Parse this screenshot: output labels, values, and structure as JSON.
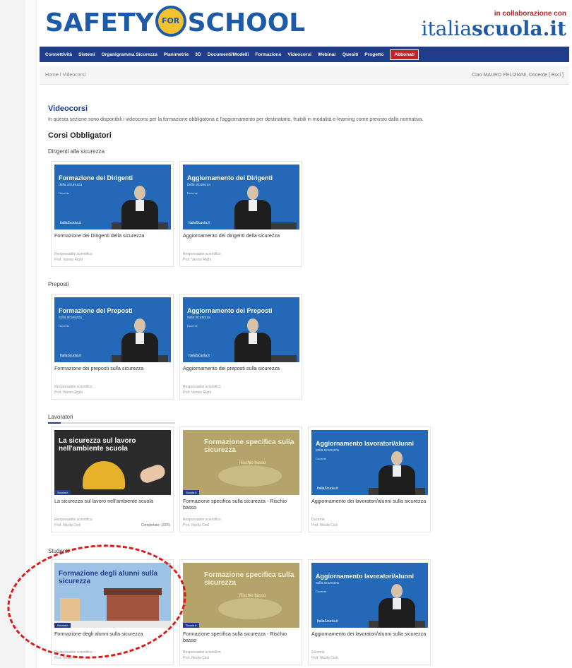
{
  "header": {
    "logo_left": "SAFETY",
    "logo_badge": "FOR",
    "logo_right": "SCHOOL",
    "partner_note": "in collaborazione con",
    "partner_light": "italia",
    "partner_bold": "scuola.it"
  },
  "nav": {
    "items": [
      "Connettività",
      "Sistemi",
      "Organigramma Sicurezza",
      "Planimetrie",
      "3D",
      "Documenti/Modelli",
      "Formazione",
      "Videocorsi",
      "Webinar",
      "Quesiti",
      "Progetto",
      "Abbonati"
    ]
  },
  "crumb": "Home / Videocorsi",
  "user": "Ciao MAURO FELIZIANI, Docente [ Esci ]",
  "section": {
    "title": "Videocorsi",
    "description": "In questa sezione sono disponibili i videocorsi per la formazione obbligatoria e l'aggiornamento per destinatario, fruibili in modalità e-learning come previsto dalla normativa.",
    "subtitle": "Corsi Obbligatori"
  },
  "groups": [
    {
      "label": "Dirigenti alla sicurezza",
      "cards": [
        {
          "thumb_title": "Formazione dei Dirigenti",
          "thumb_sub": "della sicurezza",
          "thumb_sub2": "Docente",
          "brand": "ItaliaScuola.it",
          "title": "Formazione dei Dirigenti della sicurezza",
          "meta1": "Responsabile scientifico",
          "meta2": "Prof. Vanino Righi",
          "progress": ""
        },
        {
          "thumb_title": "Aggiornamento dei Dirigenti",
          "thumb_sub": "della sicurezza",
          "thumb_sub2": "Docente",
          "brand": "ItaliaScuola.it",
          "title": "Aggiornamento dei dirigenti della sicurezza",
          "meta1": "Responsabile scientifico",
          "meta2": "Prof. Vanino Righi",
          "progress": ""
        }
      ]
    },
    {
      "label": "Preposti",
      "cards": [
        {
          "thumb_title": "Formazione dei Preposti",
          "thumb_sub": "sulla sicurezza",
          "thumb_sub2": "Docente",
          "brand": "ItaliaScuola.it",
          "title": "Formazione dei preposti sulla sicurezza",
          "meta1": "Responsabile scientifico",
          "meta2": "Prof. Vanino Righi",
          "progress": ""
        },
        {
          "thumb_title": "Aggiornamento dei Preposti",
          "thumb_sub": "sulla sicurezza",
          "thumb_sub2": "Docente",
          "brand": "ItaliaScuola.it",
          "title": "Aggiornamento dei preposti sulla sicurezza",
          "meta1": "Responsabile scientifico",
          "meta2": "Prof. Vanino Righi",
          "progress": ""
        }
      ]
    },
    {
      "label": "Lavoratori",
      "cards": [
        {
          "thumb_title": "La sicurezza sul lavoro nell'ambiente scuola",
          "thumb_sub": "",
          "thumb_sub2": "",
          "brand": "",
          "tag": "Scuola.it",
          "title": "La sicurezza sul lavoro nell'ambiente scuola",
          "meta1": "Responsabile scientifico",
          "meta2": "Prof. Nicola Cioli",
          "progress": "Completato: 100%"
        },
        {
          "thumb_title": "Formazione specifica sulla sicurezza",
          "thumb_sub": "",
          "thumb_sub2": "Rischio basso",
          "brand": "",
          "tag": "Scuola.it",
          "title": "Formazione specifica sulla sicurezza - Rischio basso",
          "meta1": "Responsabile scientifico",
          "meta2": "Prof. Nicola Cioli",
          "progress": ""
        },
        {
          "thumb_title": "Aggiornamento lavoratori/alunni",
          "thumb_sub": "sulla sicurezza",
          "thumb_sub2": "Docente",
          "brand": "ItaliaScuola.it",
          "title": "Aggiornamento dei lavoratori/alunni sulla sicurezza",
          "meta1": "Docente",
          "meta2": "Prof. Nicola Cioli",
          "progress": ""
        }
      ]
    },
    {
      "label": "Studenti",
      "cards": [
        {
          "thumb_title": "Formazione degli alunni sulla sicurezza",
          "thumb_sub": "",
          "thumb_sub2": "",
          "brand": "",
          "tag": "Scuola.it",
          "title": "Formazione degli alunni sulla sicurezza",
          "meta1": "Responsabile scientifico",
          "meta2": "Prof. Nicola Cioli",
          "progress": ""
        },
        {
          "thumb_title": "Formazione specifica sulla sicurezza",
          "thumb_sub": "",
          "thumb_sub2": "Rischio basso",
          "brand": "",
          "tag": "Scuola.it",
          "title": "Formazione specifica sulla sicurezza - Rischio basso",
          "meta1": "Responsabile scientifico",
          "meta2": "Prof. Nicola Cioli",
          "progress": ""
        },
        {
          "thumb_title": "Aggiornamento lavoratori/alunni",
          "thumb_sub": "sulla sicurezza",
          "thumb_sub2": "Docente",
          "brand": "ItaliaScuola.it",
          "title": "Aggiornamento dei lavoratori/alunni sulla sicurezza",
          "meta1": "Docente",
          "meta2": "Prof. Nicola Cioli",
          "progress": ""
        }
      ]
    }
  ],
  "colors": {
    "brand_blue": "#1d5aa8",
    "nav_blue": "#1f3d8b",
    "accent_red": "#c8202a",
    "highlight_red": "#e01818"
  }
}
